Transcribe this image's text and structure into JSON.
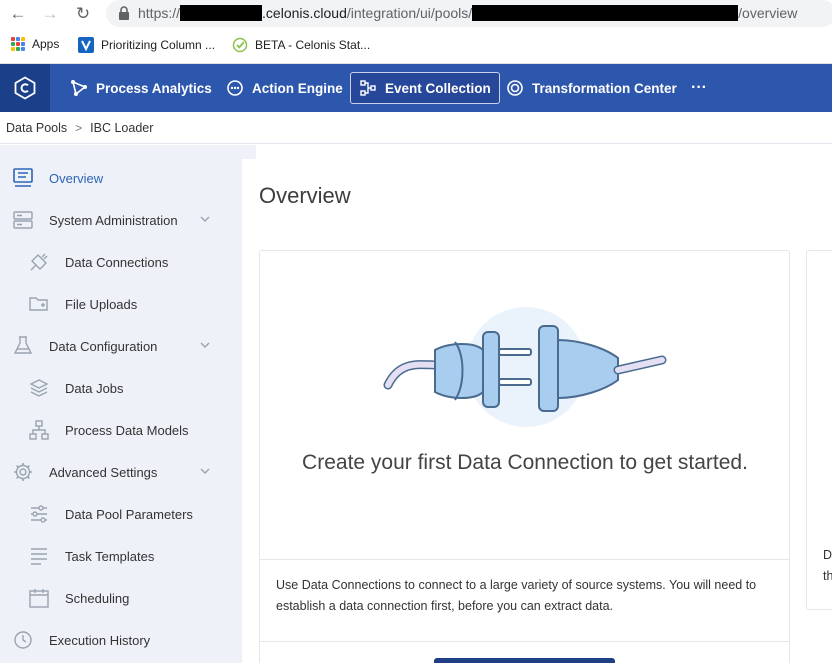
{
  "browser": {
    "url_prefix": "https://",
    "url_domain_part": ".celonis.cloud",
    "url_path": "/integration/ui/pools/",
    "url_suffix": "/overview"
  },
  "bookmarks": [
    {
      "label": "Apps",
      "icon": "apps-grid-icon"
    },
    {
      "label": "Prioritizing Column ...",
      "icon": "v-logo-icon"
    },
    {
      "label": "BETA - Celonis Stat...",
      "icon": "check-circle-icon"
    }
  ],
  "topnav": {
    "items": [
      {
        "label": "Process Analytics",
        "icon": "process-analytics-icon"
      },
      {
        "label": "Action Engine",
        "icon": "action-engine-icon"
      },
      {
        "label": "Event Collection",
        "icon": "event-collection-icon",
        "active": true
      },
      {
        "label": "Transformation Center",
        "icon": "transformation-center-icon"
      }
    ],
    "more_label": "···"
  },
  "breadcrumb": [
    "Data Pools",
    "IBC Loader"
  ],
  "sidebar": {
    "items": [
      {
        "label": "Overview",
        "icon": "overview-icon",
        "active": true
      },
      {
        "label": "System Administration",
        "icon": "server-icon",
        "expandable": true
      },
      {
        "label": "Data Connections",
        "icon": "plug-icon"
      },
      {
        "label": "File Uploads",
        "icon": "folder-plus-icon"
      },
      {
        "label": "Data Configuration",
        "icon": "flask-icon",
        "expandable": true
      },
      {
        "label": "Data Jobs",
        "icon": "layers-icon"
      },
      {
        "label": "Process Data Models",
        "icon": "hierarchy-icon"
      },
      {
        "label": "Advanced Settings",
        "icon": "gear-icon",
        "expandable": true
      },
      {
        "label": "Data Pool Parameters",
        "icon": "sliders-icon"
      },
      {
        "label": "Task Templates",
        "icon": "list-icon"
      },
      {
        "label": "Scheduling",
        "icon": "calendar-icon"
      },
      {
        "label": "Execution History",
        "icon": "history-icon"
      }
    ]
  },
  "main": {
    "title": "Overview",
    "empty_message": "Create your first Data Connection to get started.",
    "help_text": "Use Data Connections to connect to a large variety of source systems. You will need to establish a data connection first, before you can extract data.",
    "side_card_text_line1": "D",
    "side_card_text_line2": "th"
  },
  "colors": {
    "brand_blue": "#2d56ad",
    "accent_blue": "#2d64b7",
    "sidebar_bg": "#eef2f8"
  }
}
